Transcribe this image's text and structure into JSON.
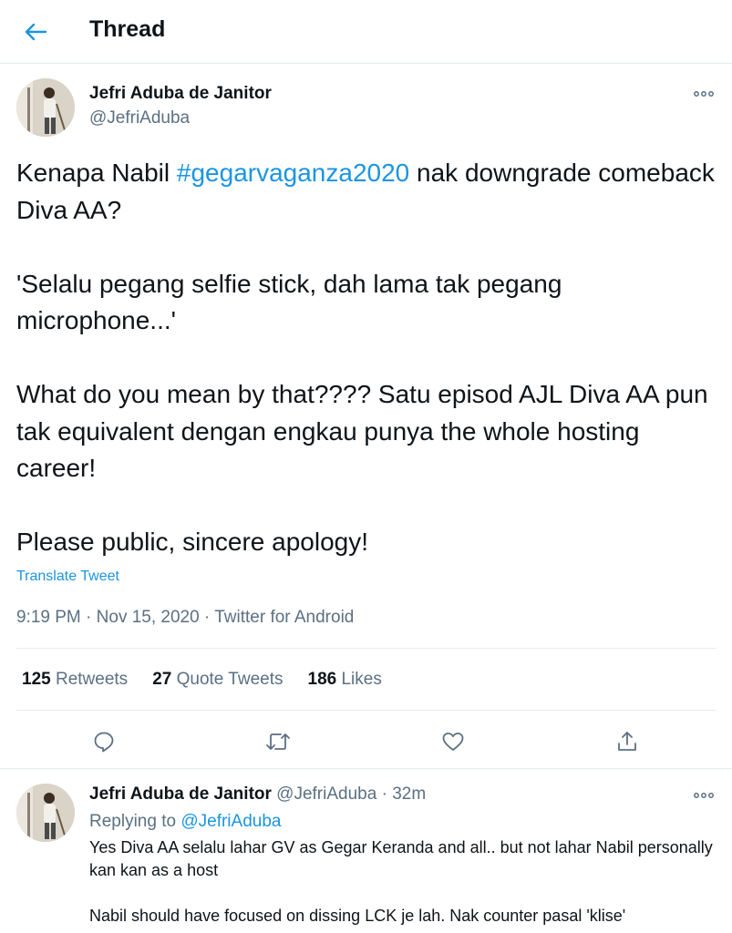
{
  "header": {
    "title": "Thread"
  },
  "tweet": {
    "author_name": "Jefri Aduba de Janitor",
    "author_handle": "@JefriAduba",
    "line1_before": "Kenapa Nabil ",
    "hashtag": "#gegarvaganza2020",
    "line1_after": " nak downgrade comeback Diva AA?",
    "para2": "'Selalu pegang selfie stick, dah lama tak pegang microphone...'",
    "para3": "What do you mean by that???? Satu episod AJL Diva AA pun tak equivalent dengan engkau punya the whole hosting career!",
    "para4": "Please public, sincere apology!",
    "translate": "Translate Tweet",
    "time": "9:19 PM",
    "date": "Nov 15, 2020",
    "source": "Twitter for Android",
    "separator": "·"
  },
  "stats": {
    "retweets_count": "125",
    "retweets_label": "Retweets",
    "quotes_count": "27",
    "quotes_label": "Quote Tweets",
    "likes_count": "186",
    "likes_label": "Likes"
  },
  "reply": {
    "author_name": "Jefri Aduba de Janitor",
    "author_handle": "@JefriAduba",
    "separator": "·",
    "time_ago": "32m",
    "replying_label": "Replying to",
    "replying_handle": "@JefriAduba",
    "para1": "Yes Diva AA selalu lahar GV as Gegar Keranda and all.. but not lahar Nabil personally kan kan as a host",
    "para2": "Nabil should have focused on dissing LCK je lah. Nak counter pasal 'klise'"
  },
  "icons": {
    "back": "arrow-left-icon",
    "more": "more-horizontal-icon",
    "reply": "reply-icon",
    "retweet": "retweet-icon",
    "like": "heart-icon",
    "share": "share-icon"
  },
  "colors": {
    "accent": "#1b95e0",
    "muted": "#5b7083",
    "text": "#0f1419",
    "divider": "#e6ecf0"
  }
}
